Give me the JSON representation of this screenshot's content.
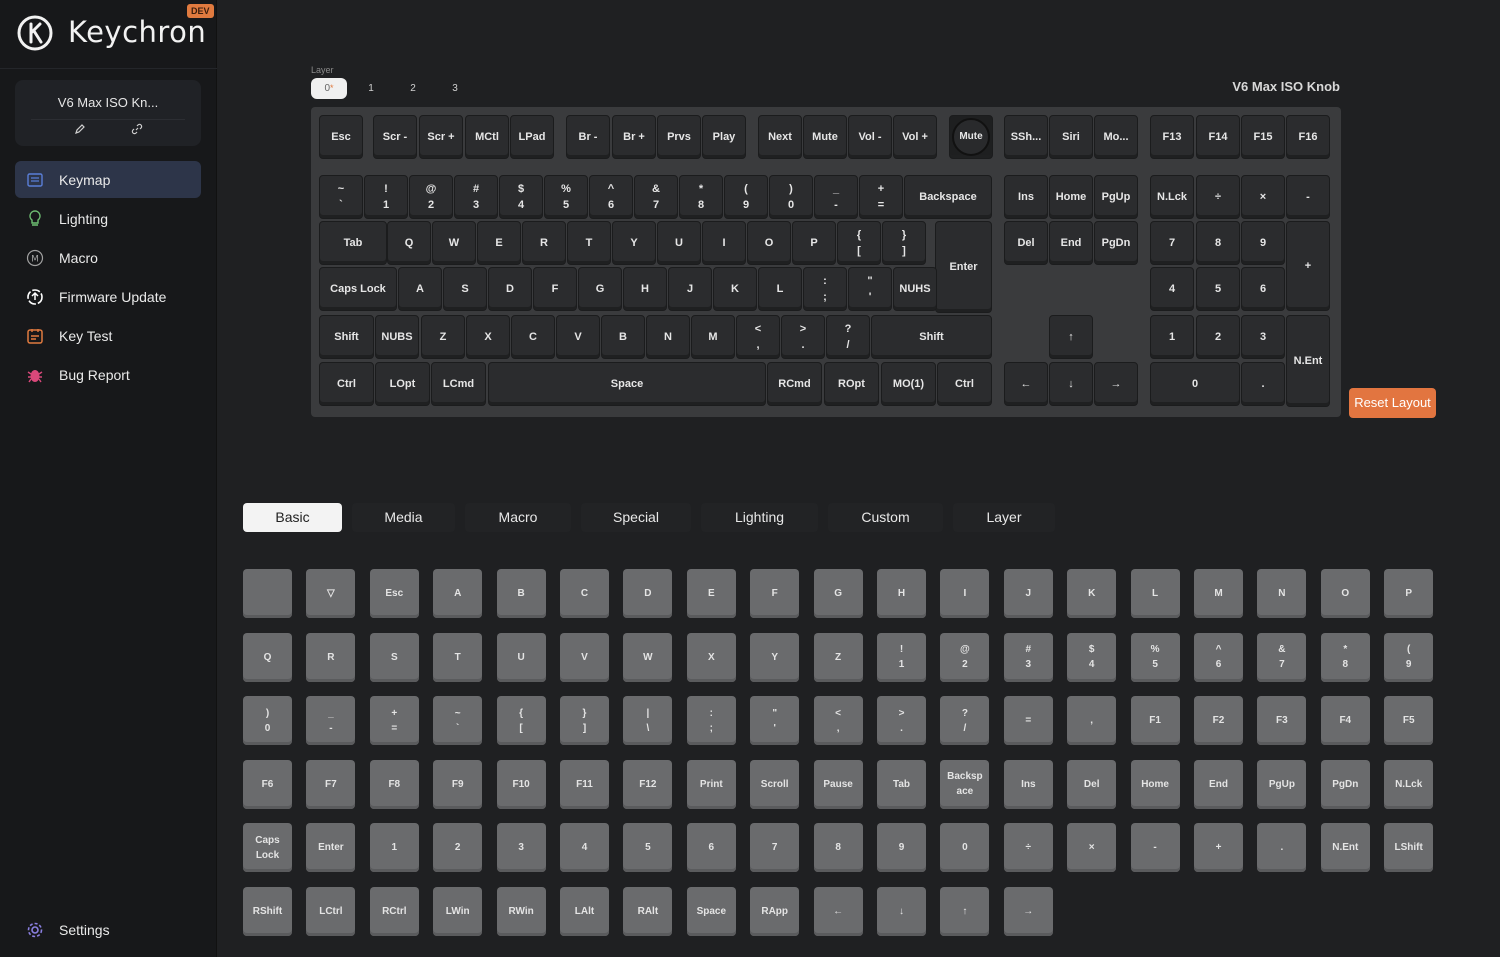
{
  "brand": {
    "name": "Keychron",
    "badge": "DEV"
  },
  "device": {
    "name": "V6 Max ISO Kn..."
  },
  "nav": [
    {
      "label": "Keymap",
      "icon": "keymap-icon",
      "color": "#5a7fd8",
      "active": true
    },
    {
      "label": "Lighting",
      "icon": "bulb-icon",
      "color": "#6fbf73",
      "active": false
    },
    {
      "label": "Macro",
      "icon": "macro-icon",
      "color": "#a0a0a0",
      "active": false
    },
    {
      "label": "Firmware Update",
      "icon": "firmware-icon",
      "color": "#ffffff",
      "active": false
    },
    {
      "label": "Key Test",
      "icon": "key-test-icon",
      "color": "#e07a3f",
      "active": false
    },
    {
      "label": "Bug Report",
      "icon": "bug-icon",
      "color": "#d9487a",
      "active": false
    }
  ],
  "settings": {
    "label": "Settings"
  },
  "layer": {
    "label": "Layer",
    "tabs": [
      "0",
      "1",
      "2",
      "3"
    ],
    "active": 0
  },
  "keyboard": {
    "name": "V6 Max ISO Knob",
    "keys": [
      {
        "top": "Esc"
      },
      {
        "top": "Scr -"
      },
      {
        "top": "Scr +"
      },
      {
        "top": "MCtl"
      },
      {
        "top": "LPad"
      },
      {
        "top": "Br -"
      },
      {
        "top": "Br +"
      },
      {
        "top": "Prvs"
      },
      {
        "top": "Play"
      },
      {
        "top": "Next"
      },
      {
        "top": "Mute"
      },
      {
        "top": "Vol -"
      },
      {
        "top": "Vol +"
      },
      {
        "top": "Mute"
      },
      {
        "top": "SSh..."
      },
      {
        "top": "Siri"
      },
      {
        "top": "Mo..."
      },
      {
        "top": "F13"
      },
      {
        "top": "F14"
      },
      {
        "top": "F15"
      },
      {
        "top": "F16"
      },
      {
        "top": "~",
        "bottom": "`"
      },
      {
        "top": "!",
        "bottom": "1"
      },
      {
        "top": "@",
        "bottom": "2"
      },
      {
        "top": "#",
        "bottom": "3"
      },
      {
        "top": "$",
        "bottom": "4"
      },
      {
        "top": "%",
        "bottom": "5"
      },
      {
        "top": "^",
        "bottom": "6"
      },
      {
        "top": "&",
        "bottom": "7"
      },
      {
        "top": "*",
        "bottom": "8"
      },
      {
        "top": "(",
        "bottom": "9"
      },
      {
        "top": ")",
        "bottom": "0"
      },
      {
        "top": "_",
        "bottom": "-"
      },
      {
        "top": "+",
        "bottom": "="
      },
      {
        "top": "Backspace"
      },
      {
        "top": "Ins"
      },
      {
        "top": "Home"
      },
      {
        "top": "PgUp"
      },
      {
        "top": "N.Lck"
      },
      {
        "top": "÷"
      },
      {
        "top": "×"
      },
      {
        "top": "-"
      },
      {
        "top": "Tab"
      },
      {
        "top": "Q"
      },
      {
        "top": "W"
      },
      {
        "top": "E"
      },
      {
        "top": "R"
      },
      {
        "top": "T"
      },
      {
        "top": "Y"
      },
      {
        "top": "U"
      },
      {
        "top": "I"
      },
      {
        "top": "O"
      },
      {
        "top": "P"
      },
      {
        "top": "{",
        "bottom": "["
      },
      {
        "top": "}",
        "bottom": "]"
      },
      {
        "top": "Enter"
      },
      {
        "top": "Del"
      },
      {
        "top": "End"
      },
      {
        "top": "PgDn"
      },
      {
        "top": "7"
      },
      {
        "top": "8"
      },
      {
        "top": "9"
      },
      {
        "top": "+"
      },
      {
        "top": "Caps Lock"
      },
      {
        "top": "A"
      },
      {
        "top": "S"
      },
      {
        "top": "D"
      },
      {
        "top": "F"
      },
      {
        "top": "G"
      },
      {
        "top": "H"
      },
      {
        "top": "J"
      },
      {
        "top": "K"
      },
      {
        "top": "L"
      },
      {
        "top": ":",
        "bottom": ";"
      },
      {
        "top": "\"",
        "bottom": "'"
      },
      {
        "top": "NUHS"
      },
      {
        "top": "4"
      },
      {
        "top": "5"
      },
      {
        "top": "6"
      },
      {
        "top": "Shift"
      },
      {
        "top": "NUBS"
      },
      {
        "top": "Z"
      },
      {
        "top": "X"
      },
      {
        "top": "C"
      },
      {
        "top": "V"
      },
      {
        "top": "B"
      },
      {
        "top": "N"
      },
      {
        "top": "M"
      },
      {
        "top": "<",
        "bottom": ","
      },
      {
        "top": ">",
        "bottom": "."
      },
      {
        "top": "?",
        "bottom": "/"
      },
      {
        "top": "Shift"
      },
      {
        "top": "↑"
      },
      {
        "top": "1"
      },
      {
        "top": "2"
      },
      {
        "top": "3"
      },
      {
        "top": "N.Ent"
      },
      {
        "top": "Ctrl"
      },
      {
        "top": "LOpt"
      },
      {
        "top": "LCmd"
      },
      {
        "top": "Space"
      },
      {
        "top": "RCmd"
      },
      {
        "top": "ROpt"
      },
      {
        "top": "MO(1)"
      },
      {
        "top": "Ctrl"
      },
      {
        "top": "←"
      },
      {
        "top": "↓"
      },
      {
        "top": "→"
      },
      {
        "top": "0"
      },
      {
        "top": "."
      }
    ]
  },
  "reset_button": "Reset Layout",
  "category_tabs": [
    "Basic",
    "Media",
    "Macro",
    "Special",
    "Lighting",
    "Custom",
    "Layer"
  ],
  "palette": [
    {
      "top": ""
    },
    {
      "top": "▽"
    },
    {
      "top": "Esc"
    },
    {
      "top": "A"
    },
    {
      "top": "B"
    },
    {
      "top": "C"
    },
    {
      "top": "D"
    },
    {
      "top": "E"
    },
    {
      "top": "F"
    },
    {
      "top": "G"
    },
    {
      "top": "H"
    },
    {
      "top": "I"
    },
    {
      "top": "J"
    },
    {
      "top": "K"
    },
    {
      "top": "L"
    },
    {
      "top": "M"
    },
    {
      "top": "N"
    },
    {
      "top": "O"
    },
    {
      "top": "P"
    },
    {
      "top": "Q"
    },
    {
      "top": "R"
    },
    {
      "top": "S"
    },
    {
      "top": "T"
    },
    {
      "top": "U"
    },
    {
      "top": "V"
    },
    {
      "top": "W"
    },
    {
      "top": "X"
    },
    {
      "top": "Y"
    },
    {
      "top": "Z"
    },
    {
      "top": "!",
      "bottom": "1"
    },
    {
      "top": "@",
      "bottom": "2"
    },
    {
      "top": "#",
      "bottom": "3"
    },
    {
      "top": "$",
      "bottom": "4"
    },
    {
      "top": "%",
      "bottom": "5"
    },
    {
      "top": "^",
      "bottom": "6"
    },
    {
      "top": "&",
      "bottom": "7"
    },
    {
      "top": "*",
      "bottom": "8"
    },
    {
      "top": "(",
      "bottom": "9"
    },
    {
      "top": ")",
      "bottom": "0"
    },
    {
      "top": "_",
      "bottom": "-"
    },
    {
      "top": "+",
      "bottom": "="
    },
    {
      "top": "~",
      "bottom": "`"
    },
    {
      "top": "{",
      "bottom": "["
    },
    {
      "top": "}",
      "bottom": "]"
    },
    {
      "top": "|",
      "bottom": "\\"
    },
    {
      "top": ":",
      "bottom": ";"
    },
    {
      "top": "\"",
      "bottom": "'"
    },
    {
      "top": "<",
      "bottom": ","
    },
    {
      "top": ">",
      "bottom": "."
    },
    {
      "top": "?",
      "bottom": "/"
    },
    {
      "top": "="
    },
    {
      "top": ","
    },
    {
      "top": "F1"
    },
    {
      "top": "F2"
    },
    {
      "top": "F3"
    },
    {
      "top": "F4"
    },
    {
      "top": "F5"
    },
    {
      "top": "F6"
    },
    {
      "top": "F7"
    },
    {
      "top": "F8"
    },
    {
      "top": "F9"
    },
    {
      "top": "F10"
    },
    {
      "top": "F11"
    },
    {
      "top": "F12"
    },
    {
      "top": "Print"
    },
    {
      "top": "Scroll"
    },
    {
      "top": "Pause"
    },
    {
      "top": "Tab"
    },
    {
      "top": "Backsp",
      "bottom": "ace"
    },
    {
      "top": "Ins"
    },
    {
      "top": "Del"
    },
    {
      "top": "Home"
    },
    {
      "top": "End"
    },
    {
      "top": "PgUp"
    },
    {
      "top": "PgDn"
    },
    {
      "top": "N.Lck"
    },
    {
      "top": "Caps",
      "bottom": "Lock"
    },
    {
      "top": "Enter"
    },
    {
      "top": "1"
    },
    {
      "top": "2"
    },
    {
      "top": "3"
    },
    {
      "top": "4"
    },
    {
      "top": "5"
    },
    {
      "top": "6"
    },
    {
      "top": "7"
    },
    {
      "top": "8"
    },
    {
      "top": "9"
    },
    {
      "top": "0"
    },
    {
      "top": "÷"
    },
    {
      "top": "×"
    },
    {
      "top": "-"
    },
    {
      "top": "+"
    },
    {
      "top": "."
    },
    {
      "top": "N.Ent"
    },
    {
      "top": "LShift"
    },
    {
      "top": "RShift"
    },
    {
      "top": "LCtrl"
    },
    {
      "top": "RCtrl"
    },
    {
      "top": "LWin"
    },
    {
      "top": "RWin"
    },
    {
      "top": "LAlt"
    },
    {
      "top": "RAlt"
    },
    {
      "top": "Space"
    },
    {
      "top": "RApp"
    },
    {
      "top": "←"
    },
    {
      "top": "↓"
    },
    {
      "top": "↑"
    },
    {
      "top": "→"
    }
  ]
}
